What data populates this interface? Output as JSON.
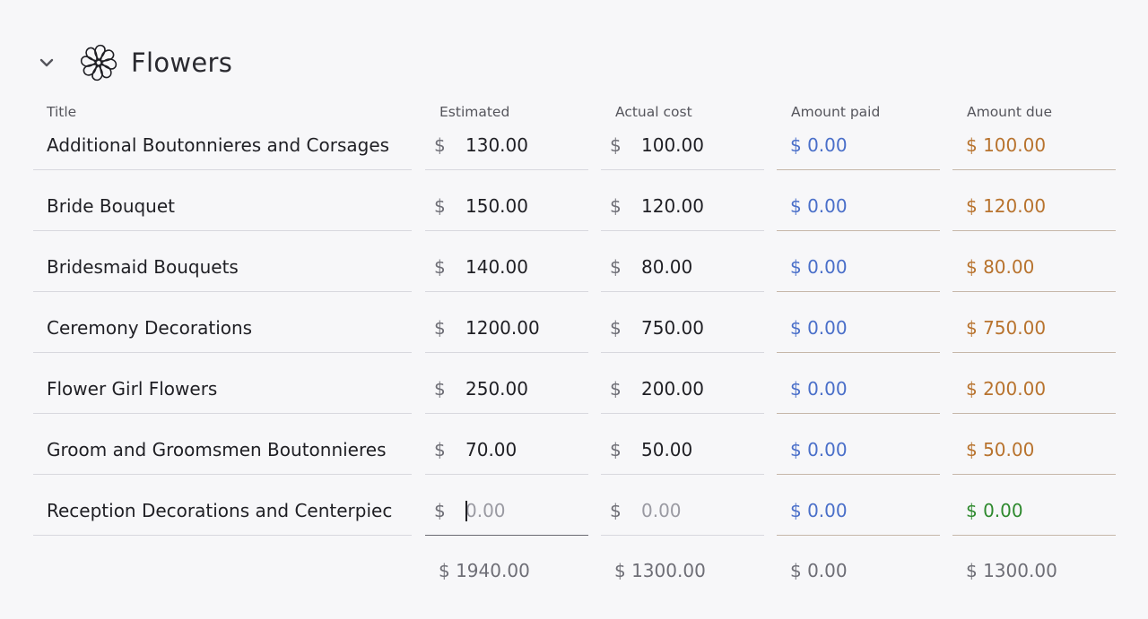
{
  "section": {
    "title": "Flowers",
    "icon": "flower-icon",
    "toggle_icon": "chevron-down-icon"
  },
  "columns": {
    "title": "Title",
    "estimated": "Estimated",
    "actual": "Actual cost",
    "paid": "Amount paid",
    "due": "Amount due"
  },
  "currency": "$",
  "rows": [
    {
      "title": "Additional Boutonnieres and Corsages",
      "estimated": "130.00",
      "actual": "100.00",
      "paid": "$ 0.00",
      "due": "$ 100.00"
    },
    {
      "title": "Bride Bouquet",
      "estimated": "150.00",
      "actual": "120.00",
      "paid": "$ 0.00",
      "due": "$ 120.00"
    },
    {
      "title": "Bridesmaid Bouquets",
      "estimated": "140.00",
      "actual": "80.00",
      "paid": "$ 0.00",
      "due": "$ 80.00"
    },
    {
      "title": "Ceremony Decorations",
      "estimated": "1200.00",
      "actual": "750.00",
      "paid": "$ 0.00",
      "due": "$ 750.00"
    },
    {
      "title": "Flower Girl Flowers",
      "estimated": "250.00",
      "actual": "200.00",
      "paid": "$ 0.00",
      "due": "$ 200.00"
    },
    {
      "title": "Groom and Groomsmen Boutonnieres",
      "estimated": "70.00",
      "actual": "50.00",
      "paid": "$ 0.00",
      "due": "$ 50.00"
    },
    {
      "title": "Reception Decorations and Centerpiec",
      "estimated_placeholder": "0.00",
      "actual_placeholder": "0.00",
      "paid": "$ 0.00",
      "due": "$ 0.00"
    }
  ],
  "totals": {
    "estimated": "$ 1940.00",
    "actual": "$ 1300.00",
    "paid": "$ 0.00",
    "due": "$ 1300.00"
  },
  "colors": {
    "paid": "#4a6fc9",
    "due": "#b8732e",
    "due_zero": "#2f8a2f",
    "background": "#f7f7f9"
  }
}
